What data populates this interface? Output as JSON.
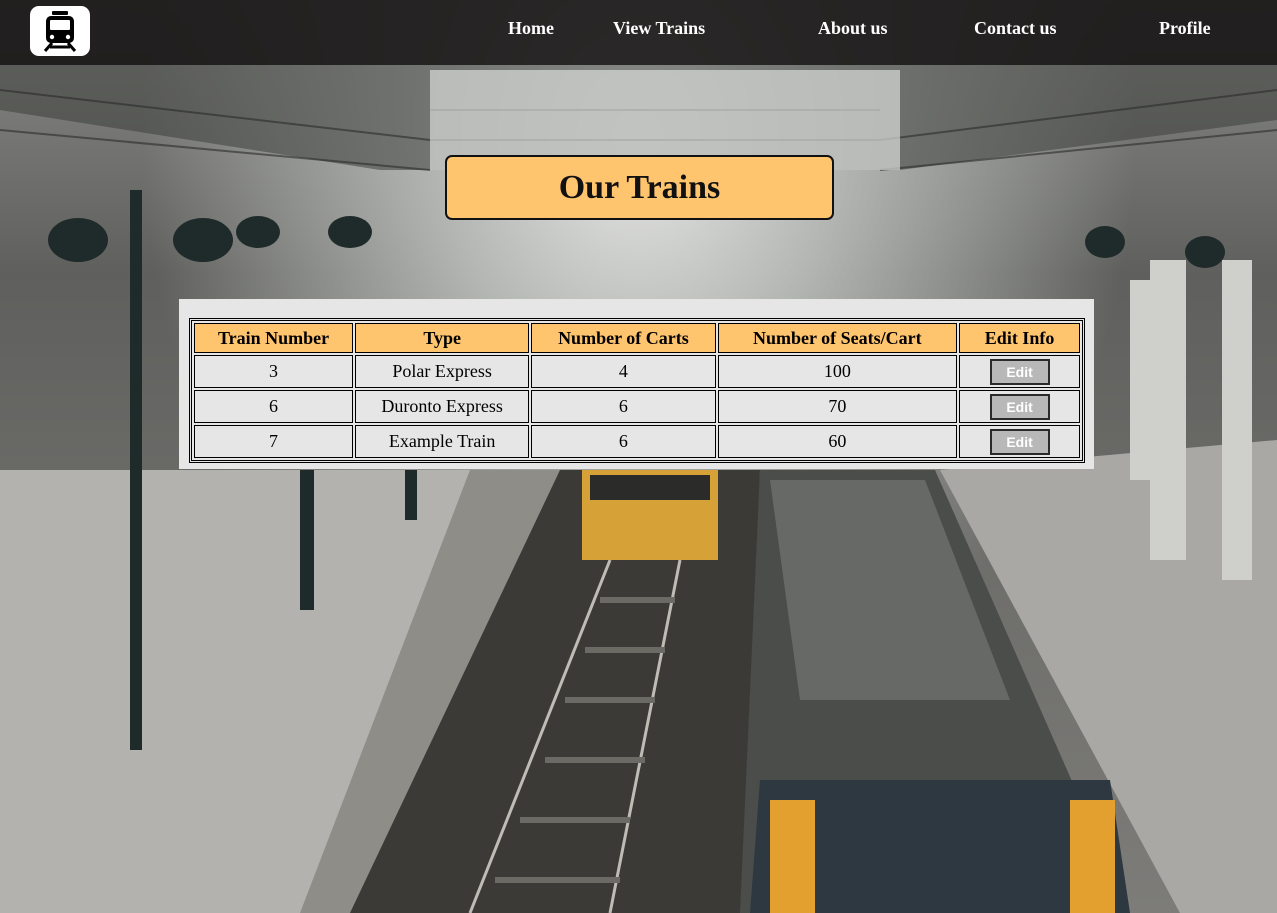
{
  "nav": {
    "logo_icon": "train-icon",
    "links": [
      {
        "label": "Home"
      },
      {
        "label": "View Trains"
      },
      {
        "label": "About us"
      },
      {
        "label": "Contact us"
      },
      {
        "label": "Profile"
      }
    ]
  },
  "page": {
    "title": "Our Trains"
  },
  "table": {
    "headers": [
      "Train Number",
      "Type",
      "Number of Carts",
      "Number of Seats/Cart",
      "Edit Info"
    ],
    "rows": [
      {
        "number": "3",
        "type": "Polar Express",
        "carts": "4",
        "seats": "100",
        "action": "Edit"
      },
      {
        "number": "6",
        "type": "Duronto Express",
        "carts": "6",
        "seats": "70",
        "action": "Edit"
      },
      {
        "number": "7",
        "type": "Example Train",
        "carts": "6",
        "seats": "60",
        "action": "Edit"
      }
    ]
  },
  "colors": {
    "accent": "#ffc46e",
    "navbar": "#161414",
    "panel": "#e6e6e6"
  }
}
